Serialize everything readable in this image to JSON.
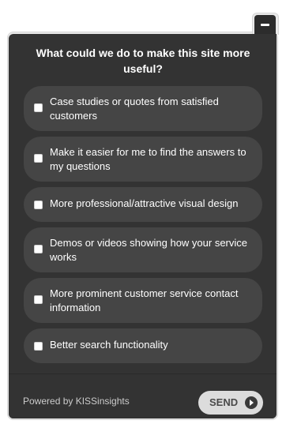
{
  "widget": {
    "question": "What could we do to make this site more useful?",
    "minimize_icon": "minimize-icon",
    "options": [
      {
        "label": "Case studies or quotes from satisfied customers",
        "checked": false
      },
      {
        "label": "Make it easier for me to find the answers to my questions",
        "checked": false
      },
      {
        "label": "More professional/attractive visual design",
        "checked": false
      },
      {
        "label": "Demos or videos showing how your service works",
        "checked": false
      },
      {
        "label": "More prominent customer service contact information",
        "checked": false
      },
      {
        "label": "Better search functionality",
        "checked": false
      }
    ],
    "footer": {
      "powered_by": "Powered by KISSinsights",
      "send_label": "SEND",
      "send_icon": "arrow-right-icon"
    }
  },
  "colors": {
    "panel": "#333333",
    "option_bg": "#454545",
    "frame": "#e9e9e9",
    "send_bg": "#dcdcdc"
  }
}
